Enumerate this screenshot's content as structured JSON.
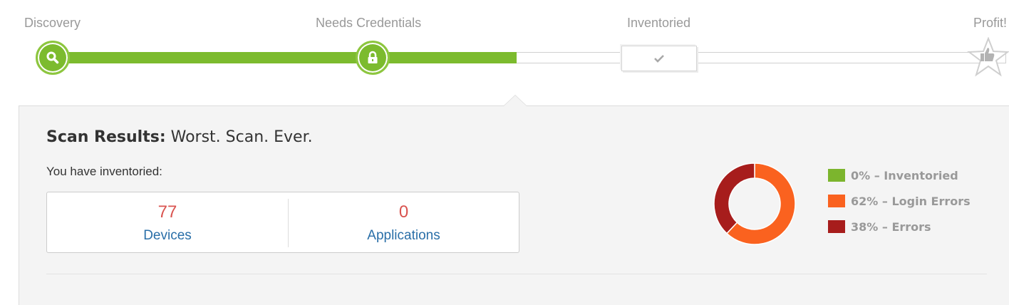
{
  "steps": [
    {
      "label": "Discovery",
      "icon": "search-icon",
      "state": "complete"
    },
    {
      "label": "Needs Credentials",
      "icon": "lock-icon",
      "state": "complete"
    },
    {
      "label": "Inventoried",
      "icon": "check-icon",
      "state": "pending"
    },
    {
      "label": "Profit!",
      "icon": "thumbs-up-star-icon",
      "state": "pending"
    }
  ],
  "progress_fraction": 0.487,
  "colors": {
    "complete": "#7cbb2e",
    "inventoried": "#7cb52d",
    "login_errors": "#fa621f",
    "errors": "#a71d1c",
    "count_red": "#d9534f",
    "link_blue": "#2a6fa8"
  },
  "scan": {
    "title_bold": "Scan Results:",
    "title_rest": "Worst. Scan. Ever.",
    "intro": "You have inventoried:"
  },
  "stats": {
    "devices": {
      "value": "77",
      "label": "Devices"
    },
    "applications": {
      "value": "0",
      "label": "Applications"
    }
  },
  "chart_data": {
    "type": "pie",
    "categories": [
      "Inventoried",
      "Login Errors",
      "Errors"
    ],
    "values": [
      0,
      62,
      38
    ],
    "legend_labels": [
      "0% – Inventoried",
      "62% – Login Errors",
      "38% – Errors"
    ],
    "colors": [
      "#7cb52d",
      "#fa621f",
      "#a71d1c"
    ],
    "donut": true,
    "legend_position": "right"
  }
}
